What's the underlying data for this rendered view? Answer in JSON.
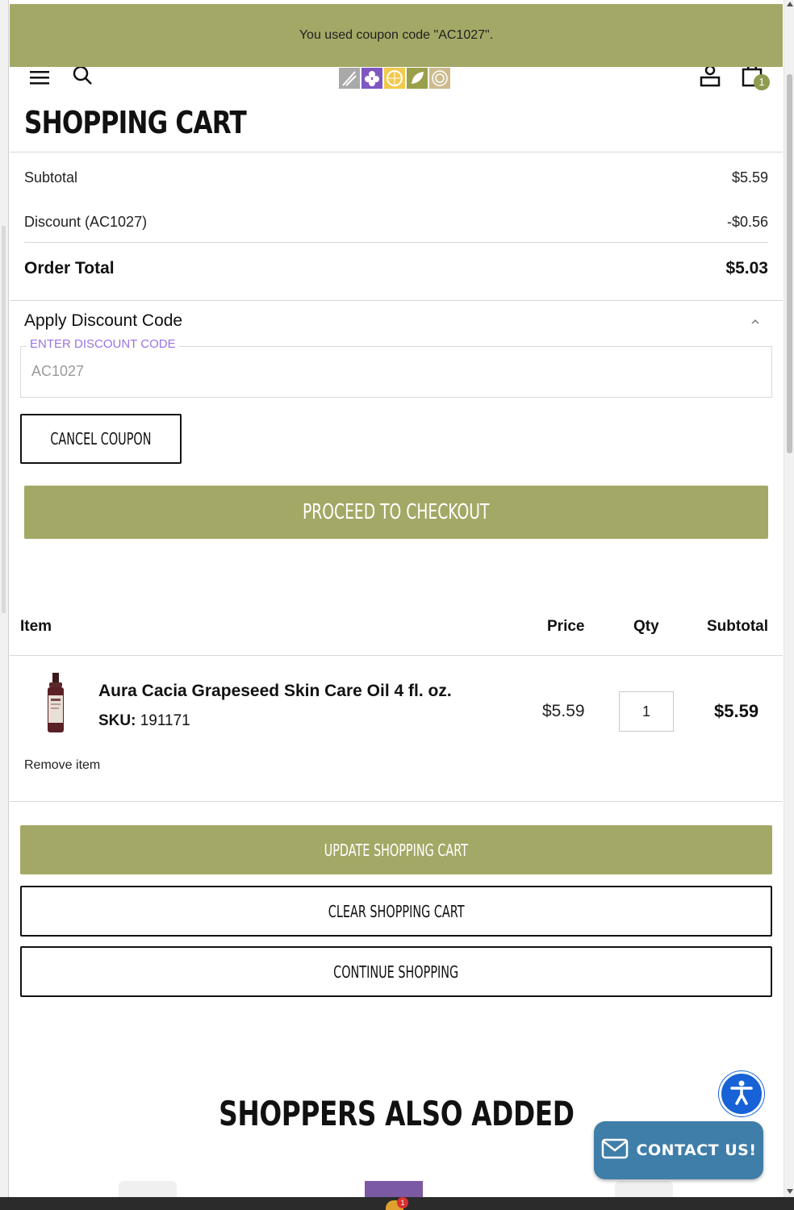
{
  "banner": {
    "message": "You used coupon code \"AC1027\"."
  },
  "header": {
    "cart_count": "1"
  },
  "page_title": "SHOPPING CART",
  "totals": {
    "subtotal_label": "Subtotal",
    "subtotal_value": "$5.59",
    "discount_label": "Discount (AC1027)",
    "discount_value": "-$0.56",
    "order_total_label": "Order Total",
    "order_total_value": "$5.03"
  },
  "discount": {
    "title": "Apply Discount Code",
    "field_label": "ENTER DISCOUNT CODE",
    "field_value": "AC1027",
    "cancel_label": "CANCEL COUPON"
  },
  "checkout_label": "PROCEED TO CHECKOUT",
  "table": {
    "headers": {
      "item": "Item",
      "price": "Price",
      "qty": "Qty",
      "subtotal": "Subtotal"
    },
    "rows": [
      {
        "name": "Aura Cacia Grapeseed Skin Care Oil 4 fl. oz.",
        "sku_label": "SKU:",
        "sku": "191171",
        "price": "$5.59",
        "qty": "1",
        "subtotal": "$5.59",
        "remove_label": "Remove item"
      }
    ]
  },
  "actions": {
    "update_label": "UPDATE SHOPPING CART",
    "clear_label": "CLEAR SHOPPING CART",
    "continue_label": "CONTINUE SHOPPING"
  },
  "also_added_title": "SHOPPERS ALSO ADDED",
  "contact_label": "CONTACT US!",
  "taskbar_badge": "1",
  "colors": {
    "brand_olive": "#a4a866",
    "accent_purple": "#9a72e0",
    "a11y_blue": "#1762d6",
    "contact_blue": "#3f7ea8"
  },
  "icons": [
    "menu-icon",
    "search-icon",
    "account-icon",
    "cart-icon",
    "chevron-up-icon",
    "accessibility-icon",
    "mail-icon"
  ]
}
